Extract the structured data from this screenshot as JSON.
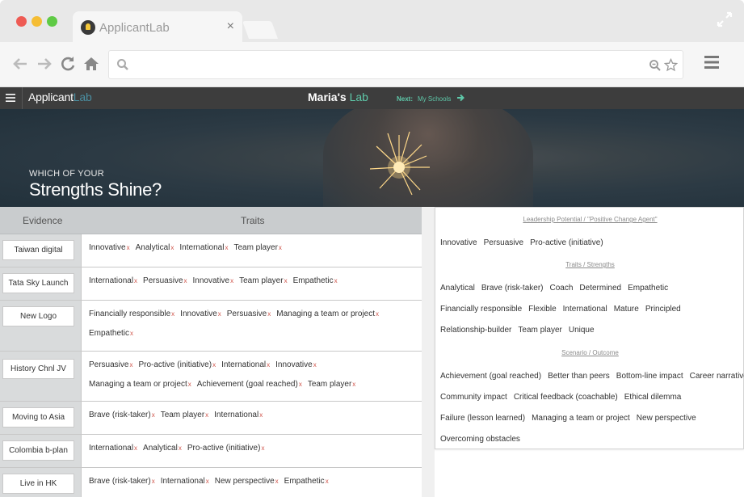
{
  "browser": {
    "tab_title": "ApplicantLab",
    "tab_close": "×"
  },
  "app": {
    "brand_main": "Applicant",
    "brand_accent": "Lab",
    "lab_owner": "Maria's",
    "lab_accent": "Lab",
    "next_label": "Next:",
    "next_link": "My Schools"
  },
  "hero": {
    "kicker": "WHICH OF YOUR",
    "title": "Strengths Shine?"
  },
  "table": {
    "evidence_header": "Evidence",
    "traits_header": "Traits",
    "remove_glyph": "x",
    "rows": [
      {
        "evidence": "Taiwan digital",
        "lines": [
          [
            "Innovative",
            "Analytical",
            "International",
            "Team player"
          ]
        ]
      },
      {
        "evidence": "Tata Sky Launch",
        "lines": [
          [
            "International",
            "Persuasive",
            "Innovative",
            "Team player",
            "Empathetic"
          ]
        ]
      },
      {
        "evidence": "New Logo",
        "lines": [
          [
            "Financially responsible",
            "Innovative",
            "Persuasive",
            "Managing a team or project"
          ],
          [
            "Empathetic"
          ]
        ]
      },
      {
        "evidence": "History Chnl JV",
        "lines": [
          [
            "Persuasive",
            "Pro-active (initiative)",
            "International",
            "Innovative"
          ],
          [
            "Managing a team or project",
            "Achievement (goal reached)",
            "Team player"
          ]
        ]
      },
      {
        "evidence": "Moving to Asia",
        "lines": [
          [
            "Brave (risk-taker)",
            "Team player",
            "International"
          ]
        ]
      },
      {
        "evidence": "Colombia b-plan",
        "lines": [
          [
            "International",
            "Analytical",
            "Pro-active (initiative)"
          ]
        ]
      },
      {
        "evidence": "Live in HK",
        "lines": [
          [
            "Brave (risk-taker)",
            "International",
            "New perspective",
            "Empathetic"
          ]
        ]
      }
    ]
  },
  "panel": {
    "sections": [
      {
        "title": "Leadership Potential / \"Positive Change Agent\"",
        "rows": [
          [
            "Innovative",
            "Persuasive",
            "Pro-active (initiative)"
          ]
        ]
      },
      {
        "title": "Traits / Strengths",
        "rows": [
          [
            "Analytical",
            "Brave (risk-taker)",
            "Coach",
            "Determined",
            "Empathetic"
          ],
          [
            "Financially responsible",
            "Flexible",
            "International",
            "Mature",
            "Principled"
          ],
          [
            "Relationship-builder",
            "Team player",
            "Unique"
          ]
        ]
      },
      {
        "title": "Scenario / Outcome",
        "rows": [
          [
            "Achievement (goal reached)",
            "Better than peers",
            "Bottom-line impact",
            "Career narrative"
          ],
          [
            "Community impact",
            "Critical feedback (coachable)",
            "Ethical dilemma"
          ],
          [
            "Failure (lesson learned)",
            "Managing a team or project",
            "New perspective"
          ],
          [
            "Overcoming obstacles"
          ]
        ]
      }
    ]
  },
  "colors": {
    "accent_teal": "#5ec8a9",
    "remove_red": "#d0554b",
    "header_dark": "#3d3d3d"
  }
}
